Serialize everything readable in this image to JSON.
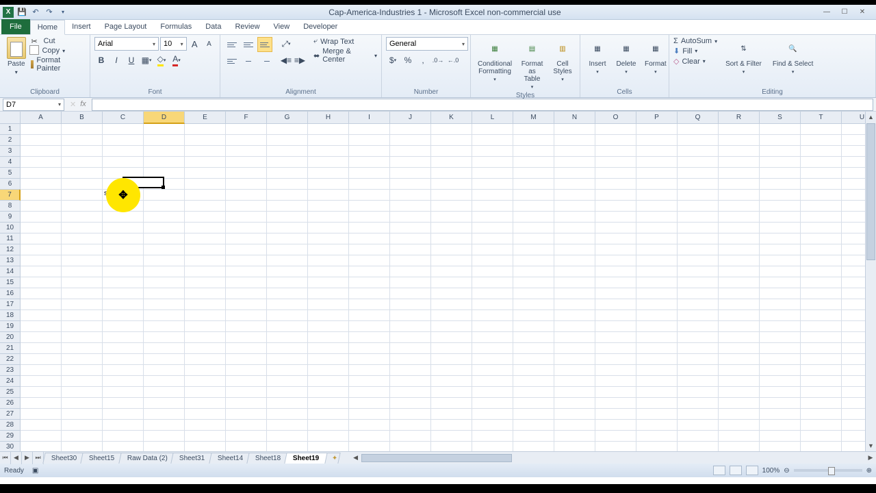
{
  "title": "Cap-America-Industries 1 - Microsoft Excel non-commercial use",
  "tabs": {
    "file": "File",
    "items": [
      "Home",
      "Insert",
      "Page Layout",
      "Formulas",
      "Data",
      "Review",
      "View",
      "Developer"
    ],
    "active": 0
  },
  "clipboard": {
    "paste": "Paste",
    "cut": "Cut",
    "copy": "Copy",
    "fmt": "Format Painter",
    "label": "Clipboard"
  },
  "font": {
    "name": "Arial",
    "size": "10",
    "label": "Font"
  },
  "alignment": {
    "wrap": "Wrap Text",
    "merge": "Merge & Center",
    "label": "Alignment"
  },
  "number": {
    "format": "General",
    "label": "Number"
  },
  "styles": {
    "cond": "Conditional Formatting",
    "table": "Format as Table",
    "cell": "Cell Styles",
    "label": "Styles"
  },
  "cells": {
    "insert": "Insert",
    "delete": "Delete",
    "format": "Format",
    "label": "Cells"
  },
  "editing": {
    "sum": "AutoSum",
    "fill": "Fill",
    "clear": "Clear",
    "sort": "Sort & Filter",
    "find": "Find & Select",
    "label": "Editing"
  },
  "namebox": "D7",
  "formula": "",
  "columns": [
    "A",
    "B",
    "C",
    "D",
    "E",
    "F",
    "G",
    "H",
    "I",
    "J",
    "K",
    "L",
    "M",
    "N",
    "O",
    "P",
    "Q",
    "R",
    "S",
    "T",
    "U"
  ],
  "rows_visible": 30,
  "selected": {
    "col": "D",
    "row": 7,
    "col_index": 3
  },
  "cell_text": {
    "C7": "s"
  },
  "sheets": [
    "Sheet30",
    "Sheet15",
    "Raw Data (2)",
    "Sheet31",
    "Sheet14",
    "Sheet18",
    "Sheet19"
  ],
  "active_sheet": 6,
  "status": "Ready",
  "zoom": "100%"
}
